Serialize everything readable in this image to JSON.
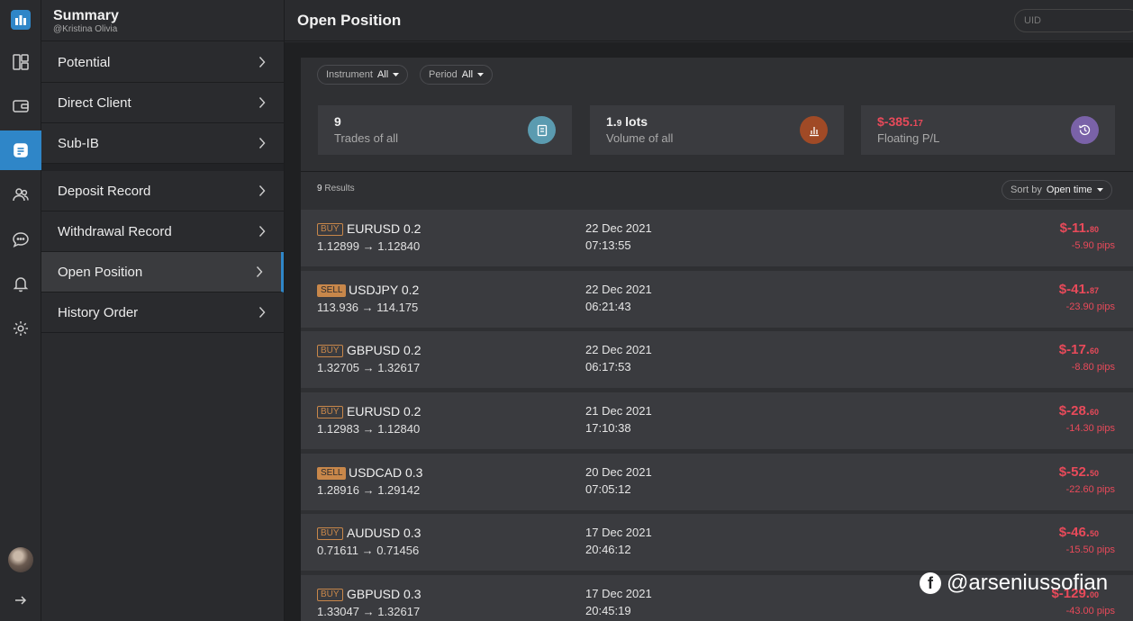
{
  "panel": {
    "title": "Summary",
    "subtitle": "@Kristina Olivia"
  },
  "menu": [
    {
      "label": "Potential"
    },
    {
      "label": "Direct Client"
    },
    {
      "label": "Sub-IB"
    },
    {
      "label": "Deposit Record"
    },
    {
      "label": "Withdrawal Record"
    },
    {
      "label": "Open Position",
      "active": true
    },
    {
      "label": "History Order"
    }
  ],
  "header": {
    "title": "Open Position",
    "uid_placeholder": "UID"
  },
  "filters": [
    {
      "label": "Instrument",
      "value": "All"
    },
    {
      "label": "Period",
      "value": "All"
    }
  ],
  "stats": [
    {
      "value": "9",
      "label": "Trades of all",
      "icon": "document-icon",
      "color": "#5b9bb0"
    },
    {
      "value_main": "1.",
      "value_small": "9",
      "value_unit": " lots",
      "label": "Volume of all",
      "icon": "bar-chart-icon",
      "color": "#a04a26"
    },
    {
      "value_main": "$-385.",
      "value_small": "17",
      "label": "Floating P/L",
      "icon": "clock-history-icon",
      "color": "#7a62a8"
    }
  ],
  "results": {
    "count": "9",
    "label": " Results",
    "sort_label": "Sort by",
    "sort_value": "Open time"
  },
  "rows": [
    {
      "side": "BUY",
      "symbol": "EURUSD 0.2",
      "prices": "1.12899 → 1.12840",
      "date": "22 Dec 2021",
      "time": "07:13:55",
      "pl_main": "$-11.",
      "pl_small": "80",
      "pips": "-5.90 pips"
    },
    {
      "side": "SELL",
      "symbol": "USDJPY 0.2",
      "prices": "113.936 → 114.175",
      "date": "22 Dec 2021",
      "time": "06:21:43",
      "pl_main": "$-41.",
      "pl_small": "87",
      "pips": "-23.90 pips"
    },
    {
      "side": "BUY",
      "symbol": "GBPUSD 0.2",
      "prices": "1.32705 → 1.32617",
      "date": "22 Dec 2021",
      "time": "06:17:53",
      "pl_main": "$-17.",
      "pl_small": "60",
      "pips": "-8.80 pips"
    },
    {
      "side": "BUY",
      "symbol": "EURUSD 0.2",
      "prices": "1.12983 → 1.12840",
      "date": "21 Dec 2021",
      "time": "17:10:38",
      "pl_main": "$-28.",
      "pl_small": "60",
      "pips": "-14.30 pips"
    },
    {
      "side": "SELL",
      "symbol": "USDCAD 0.3",
      "prices": "1.28916 → 1.29142",
      "date": "20 Dec 2021",
      "time": "07:05:12",
      "pl_main": "$-52.",
      "pl_small": "50",
      "pips": "-22.60 pips"
    },
    {
      "side": "BUY",
      "symbol": "AUDUSD 0.3",
      "prices": "0.71611 → 0.71456",
      "date": "17 Dec 2021",
      "time": "20:46:12",
      "pl_main": "$-46.",
      "pl_small": "50",
      "pips": "-15.50 pips"
    },
    {
      "side": "BUY",
      "symbol": "GBPUSD 0.3",
      "prices": "1.33047 → 1.32617",
      "date": "17 Dec 2021",
      "time": "20:45:19",
      "pl_main": "$-129.",
      "pl_small": "00",
      "pips": "-43.00 pips"
    }
  ],
  "watermark": {
    "text": "@arseniussofian"
  },
  "colors": {
    "accent": "#2f86c8",
    "negative": "#e84a5a",
    "badge": "#c8874a"
  }
}
